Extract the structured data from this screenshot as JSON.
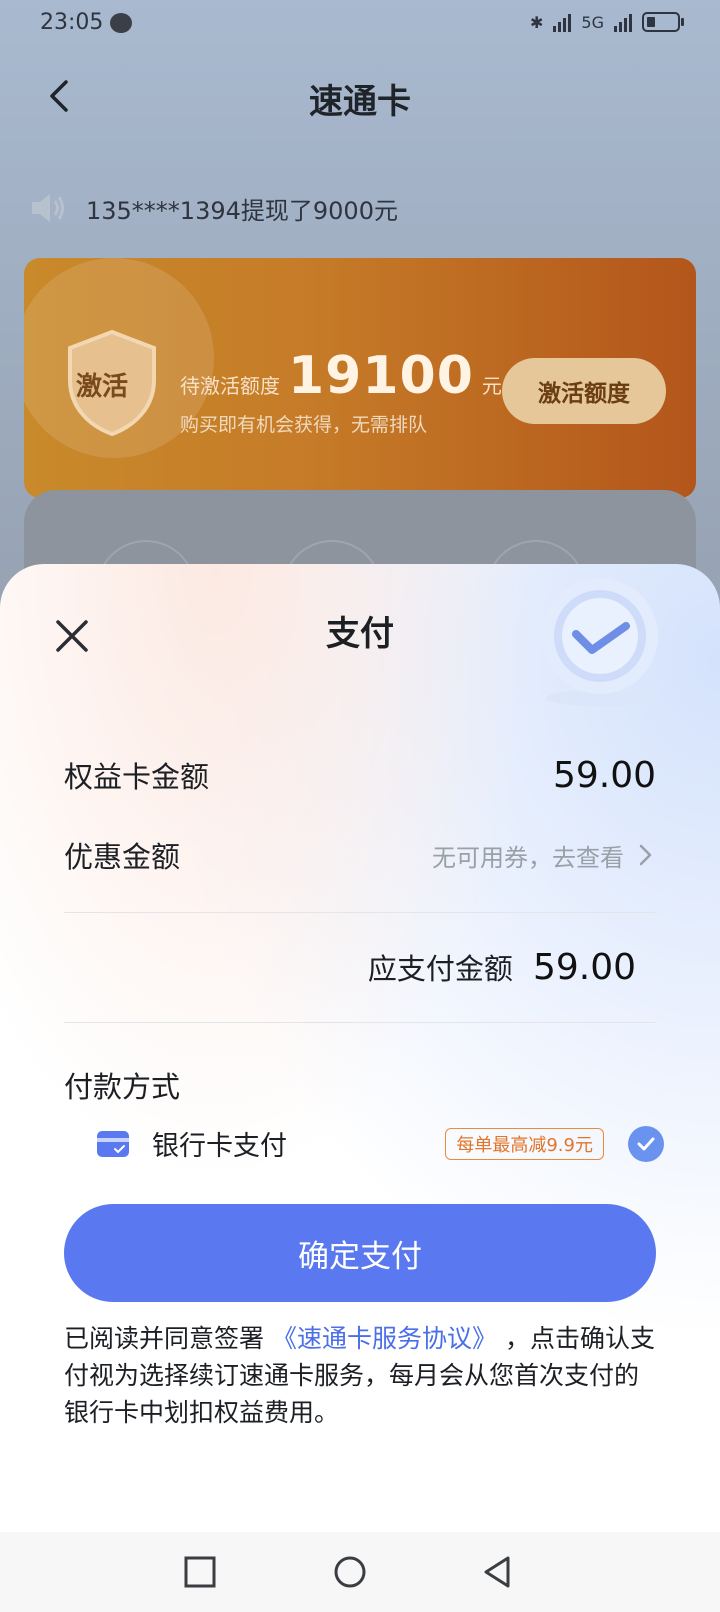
{
  "status_bar": {
    "time": "23:05",
    "network": "5G"
  },
  "nav": {
    "title": "速通卡"
  },
  "notice": {
    "text": "135****1394提现了9000元"
  },
  "promo": {
    "shield_text": "激活",
    "label": "待激活额度",
    "amount": "19100",
    "unit": "元",
    "subtitle": "购买即有机会获得，无需排队",
    "button": "激活额度"
  },
  "sheet": {
    "title": "支付",
    "card_amount_label": "权益卡金额",
    "card_amount_value": "59.00",
    "discount_label": "优惠金额",
    "discount_value": "无可用券，去查看",
    "total_label": "应支付金额",
    "total_value": "59.00",
    "payment_method_title": "付款方式",
    "payment_method": {
      "name": "银行卡支付",
      "badge": "每单最高减9.9元",
      "selected": true
    },
    "confirm_button": "确定支付",
    "agreement": {
      "prefix": "已阅读并同意签署",
      "link": "《速通卡服务协议》",
      "suffix": "，点击确认支付视为选择续订速通卡服务，每月会从您首次支付的银行卡中划扣权益费用。"
    }
  },
  "colors": {
    "primary": "#5a78f0",
    "badge": "#e2752a",
    "link": "#4a6fe8"
  }
}
